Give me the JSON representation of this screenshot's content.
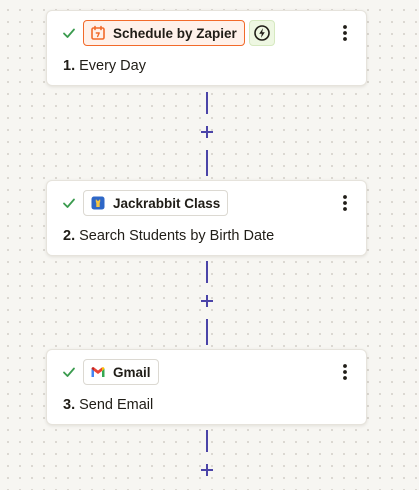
{
  "colors": {
    "canvas": "#f7f6f2",
    "connector": "#4b44a8",
    "check": "#3a9b4e",
    "trigger_accent": "#f26a2a"
  },
  "steps": [
    {
      "app": "Schedule by Zapier",
      "app_icon": "calendar-icon",
      "number": "1.",
      "title": "Every Day",
      "status": "check-icon",
      "instant_badge": "lightning-icon"
    },
    {
      "app": "Jackrabbit Class",
      "app_icon": "jackrabbit-icon",
      "number": "2.",
      "title": "Search Students by Birth Date",
      "status": "check-icon"
    },
    {
      "app": "Gmail",
      "app_icon": "gmail-icon",
      "number": "3.",
      "title": "Send Email",
      "status": "check-icon"
    }
  ]
}
